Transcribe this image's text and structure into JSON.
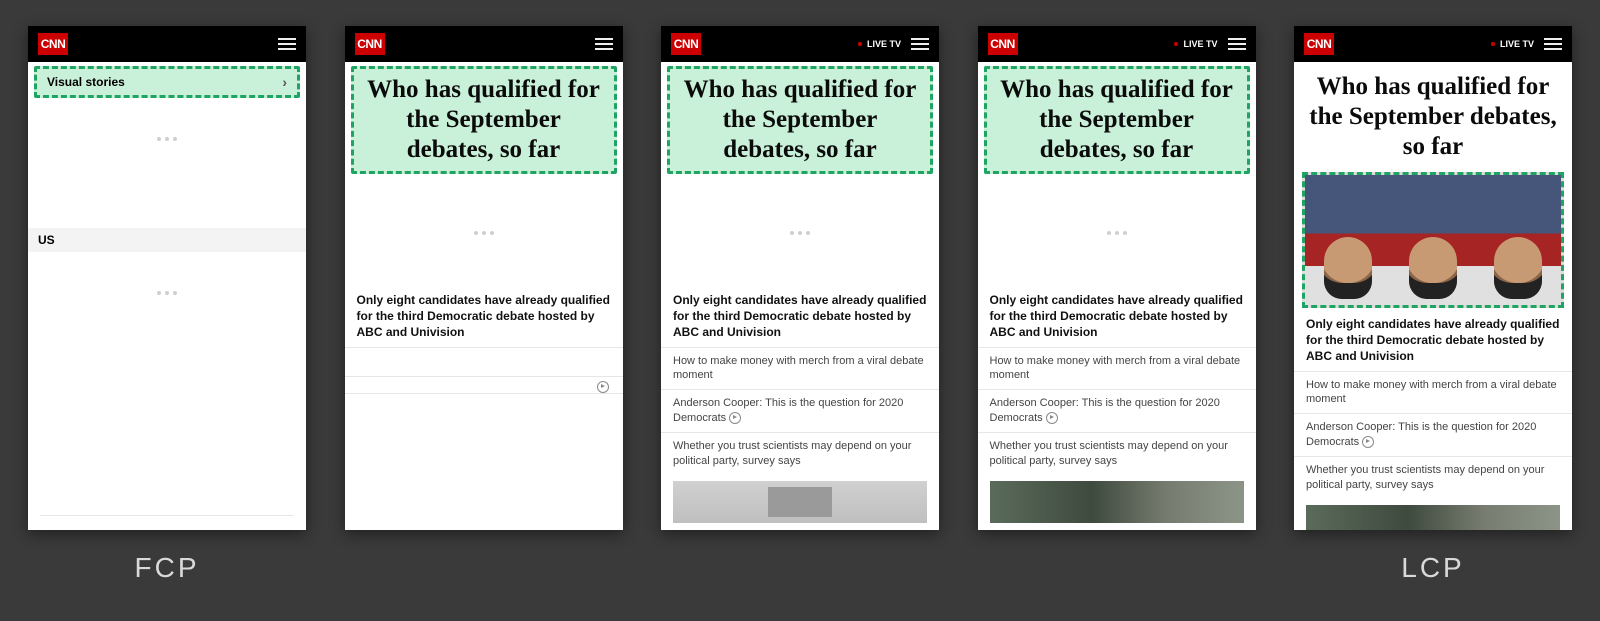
{
  "logo_text": "CNN",
  "live_label": "LIVE TV",
  "section_visual": "Visual stories",
  "section_us": "US",
  "headline": "Who has qualified for the September debates, so far",
  "subhead": "Only eight candidates have already qualified for the third Democratic debate hosted by ABC and Univision",
  "links": [
    "How to make money with merch from a viral debate moment",
    "Anderson Cooper: This is the question for 2020 Democrats",
    "Whether you trust scientists may depend on your political party, survey says"
  ],
  "metric_fcp": "FCP",
  "metric_lcp": "LCP"
}
